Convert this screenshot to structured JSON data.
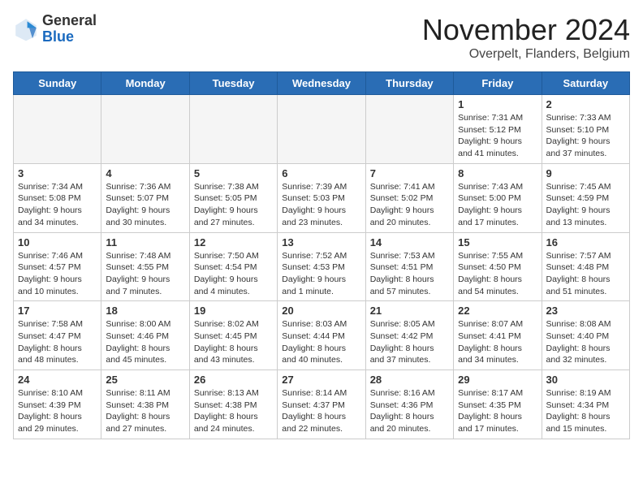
{
  "logo": {
    "general": "General",
    "blue": "Blue"
  },
  "title": "November 2024",
  "location": "Overpelt, Flanders, Belgium",
  "weekdays": [
    "Sunday",
    "Monday",
    "Tuesday",
    "Wednesday",
    "Thursday",
    "Friday",
    "Saturday"
  ],
  "weeks": [
    [
      {
        "day": "",
        "info": ""
      },
      {
        "day": "",
        "info": ""
      },
      {
        "day": "",
        "info": ""
      },
      {
        "day": "",
        "info": ""
      },
      {
        "day": "",
        "info": ""
      },
      {
        "day": "1",
        "info": "Sunrise: 7:31 AM\nSunset: 5:12 PM\nDaylight: 9 hours\nand 41 minutes."
      },
      {
        "day": "2",
        "info": "Sunrise: 7:33 AM\nSunset: 5:10 PM\nDaylight: 9 hours\nand 37 minutes."
      }
    ],
    [
      {
        "day": "3",
        "info": "Sunrise: 7:34 AM\nSunset: 5:08 PM\nDaylight: 9 hours\nand 34 minutes."
      },
      {
        "day": "4",
        "info": "Sunrise: 7:36 AM\nSunset: 5:07 PM\nDaylight: 9 hours\nand 30 minutes."
      },
      {
        "day": "5",
        "info": "Sunrise: 7:38 AM\nSunset: 5:05 PM\nDaylight: 9 hours\nand 27 minutes."
      },
      {
        "day": "6",
        "info": "Sunrise: 7:39 AM\nSunset: 5:03 PM\nDaylight: 9 hours\nand 23 minutes."
      },
      {
        "day": "7",
        "info": "Sunrise: 7:41 AM\nSunset: 5:02 PM\nDaylight: 9 hours\nand 20 minutes."
      },
      {
        "day": "8",
        "info": "Sunrise: 7:43 AM\nSunset: 5:00 PM\nDaylight: 9 hours\nand 17 minutes."
      },
      {
        "day": "9",
        "info": "Sunrise: 7:45 AM\nSunset: 4:59 PM\nDaylight: 9 hours\nand 13 minutes."
      }
    ],
    [
      {
        "day": "10",
        "info": "Sunrise: 7:46 AM\nSunset: 4:57 PM\nDaylight: 9 hours\nand 10 minutes."
      },
      {
        "day": "11",
        "info": "Sunrise: 7:48 AM\nSunset: 4:55 PM\nDaylight: 9 hours\nand 7 minutes."
      },
      {
        "day": "12",
        "info": "Sunrise: 7:50 AM\nSunset: 4:54 PM\nDaylight: 9 hours\nand 4 minutes."
      },
      {
        "day": "13",
        "info": "Sunrise: 7:52 AM\nSunset: 4:53 PM\nDaylight: 9 hours\nand 1 minute."
      },
      {
        "day": "14",
        "info": "Sunrise: 7:53 AM\nSunset: 4:51 PM\nDaylight: 8 hours\nand 57 minutes."
      },
      {
        "day": "15",
        "info": "Sunrise: 7:55 AM\nSunset: 4:50 PM\nDaylight: 8 hours\nand 54 minutes."
      },
      {
        "day": "16",
        "info": "Sunrise: 7:57 AM\nSunset: 4:48 PM\nDaylight: 8 hours\nand 51 minutes."
      }
    ],
    [
      {
        "day": "17",
        "info": "Sunrise: 7:58 AM\nSunset: 4:47 PM\nDaylight: 8 hours\nand 48 minutes."
      },
      {
        "day": "18",
        "info": "Sunrise: 8:00 AM\nSunset: 4:46 PM\nDaylight: 8 hours\nand 45 minutes."
      },
      {
        "day": "19",
        "info": "Sunrise: 8:02 AM\nSunset: 4:45 PM\nDaylight: 8 hours\nand 43 minutes."
      },
      {
        "day": "20",
        "info": "Sunrise: 8:03 AM\nSunset: 4:44 PM\nDaylight: 8 hours\nand 40 minutes."
      },
      {
        "day": "21",
        "info": "Sunrise: 8:05 AM\nSunset: 4:42 PM\nDaylight: 8 hours\nand 37 minutes."
      },
      {
        "day": "22",
        "info": "Sunrise: 8:07 AM\nSunset: 4:41 PM\nDaylight: 8 hours\nand 34 minutes."
      },
      {
        "day": "23",
        "info": "Sunrise: 8:08 AM\nSunset: 4:40 PM\nDaylight: 8 hours\nand 32 minutes."
      }
    ],
    [
      {
        "day": "24",
        "info": "Sunrise: 8:10 AM\nSunset: 4:39 PM\nDaylight: 8 hours\nand 29 minutes."
      },
      {
        "day": "25",
        "info": "Sunrise: 8:11 AM\nSunset: 4:38 PM\nDaylight: 8 hours\nand 27 minutes."
      },
      {
        "day": "26",
        "info": "Sunrise: 8:13 AM\nSunset: 4:38 PM\nDaylight: 8 hours\nand 24 minutes."
      },
      {
        "day": "27",
        "info": "Sunrise: 8:14 AM\nSunset: 4:37 PM\nDaylight: 8 hours\nand 22 minutes."
      },
      {
        "day": "28",
        "info": "Sunrise: 8:16 AM\nSunset: 4:36 PM\nDaylight: 8 hours\nand 20 minutes."
      },
      {
        "day": "29",
        "info": "Sunrise: 8:17 AM\nSunset: 4:35 PM\nDaylight: 8 hours\nand 17 minutes."
      },
      {
        "day": "30",
        "info": "Sunrise: 8:19 AM\nSunset: 4:34 PM\nDaylight: 8 hours\nand 15 minutes."
      }
    ]
  ]
}
